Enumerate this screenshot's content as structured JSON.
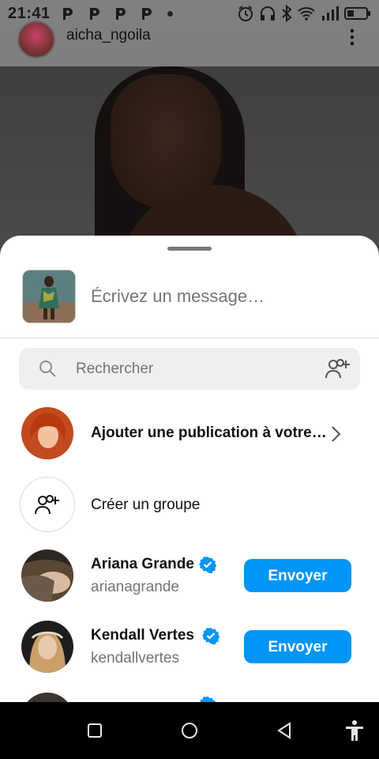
{
  "status_bar": {
    "time": "21:41",
    "icons": [
      "p-notification-icon",
      "p-notification-icon",
      "p-notification-icon",
      "p-notification-icon",
      "dot-icon",
      "alarm-icon",
      "headset-icon",
      "bluetooth-icon",
      "wifi-icon",
      "signal-icon",
      "battery-icon"
    ]
  },
  "post": {
    "username": "aicha_ngoila",
    "more_icon": "more-vertical-icon"
  },
  "share_sheet": {
    "message_placeholder": "Écrivez un message…",
    "search_placeholder": "Rechercher",
    "add_people_icon": "add-people-icon",
    "add_to_story_label": "Ajouter une publication à votre…",
    "create_group_label": "Créer un groupe",
    "contacts": [
      {
        "name": "Ariana Grande",
        "username": "arianagrande",
        "verified": true,
        "button": "Envoyer"
      },
      {
        "name": "Kendall Vertes",
        "username": "kendallvertes",
        "verified": true,
        "button": "Envoyer"
      }
    ]
  },
  "nav_bar": {
    "icons": [
      "recents-square-icon",
      "home-circle-icon",
      "back-triangle-icon",
      "accessibility-icon"
    ]
  },
  "colors": {
    "accent": "#0095f6",
    "overlay": "#808080",
    "verified": "#0095f6"
  }
}
